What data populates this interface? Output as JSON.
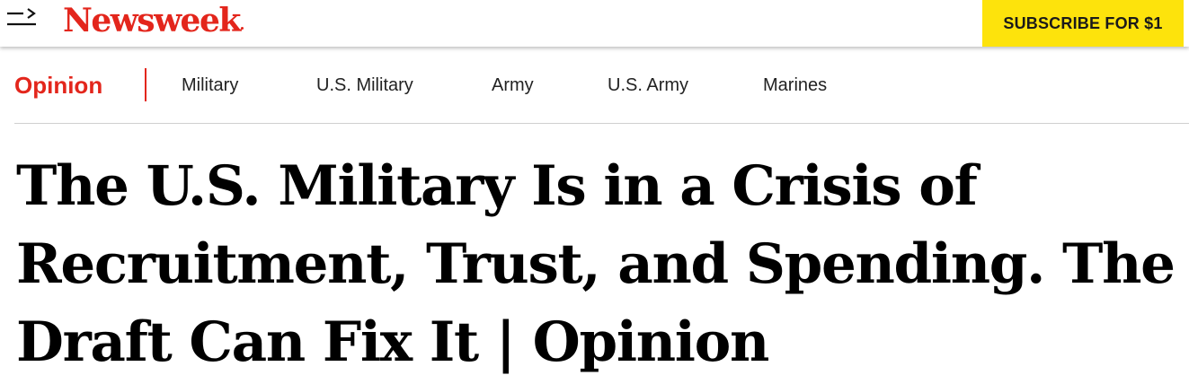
{
  "header": {
    "menu_icon": "menu-arrow-icon",
    "logo_text": "Newsweek",
    "subscribe_label": "SUBSCRIBE FOR $1"
  },
  "subnav": {
    "section": "Opinion",
    "tags": [
      "Military",
      "U.S. Military",
      "Army",
      "U.S. Army",
      "Marines"
    ]
  },
  "article": {
    "headline": "The U.S. Military Is in a Crisis of Recruitment, Trust, and Spending. The Draft Can Fix It | Opinion"
  },
  "colors": {
    "brand_red": "#e3261c",
    "subscribe_bg": "#fde30c",
    "subscribe_text": "#1a1a1a",
    "text": "#000000"
  }
}
